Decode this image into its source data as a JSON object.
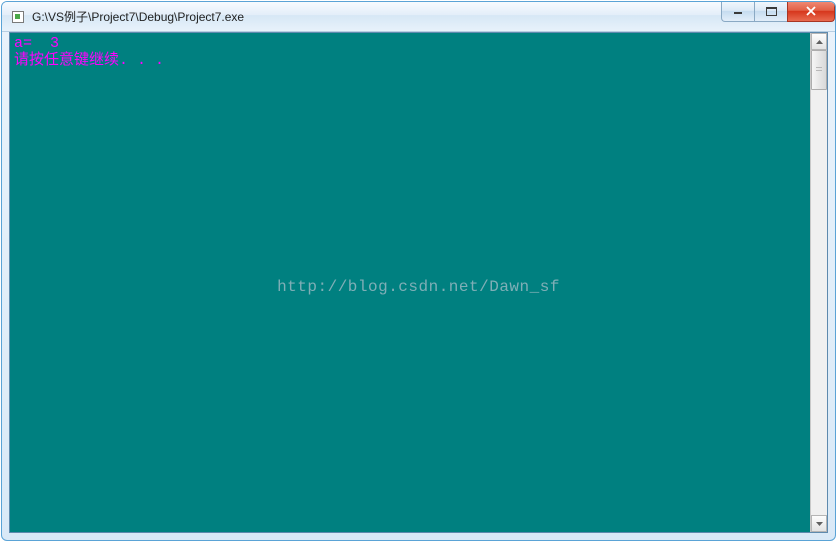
{
  "window": {
    "title": "G:\\VS例子\\Project7\\Debug\\Project7.exe"
  },
  "console": {
    "line1": "a=  3",
    "line2": "请按任意键继续. . ."
  },
  "watermark": {
    "text": "http://blog.csdn.net/Dawn_sf"
  }
}
